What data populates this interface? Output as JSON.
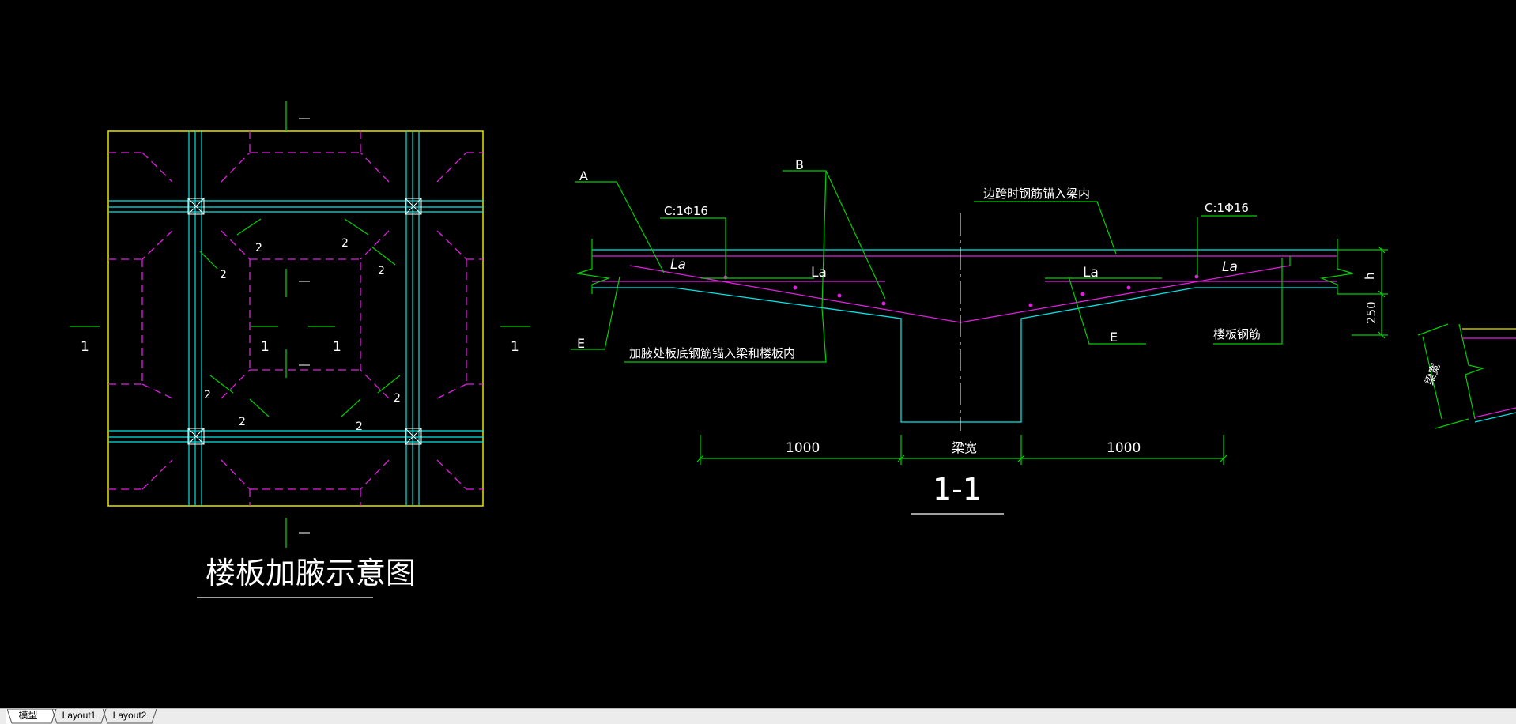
{
  "drawing": {
    "plan_title": "楼板加腋示意图",
    "section_title": "1-1",
    "plan_section_mark": "1",
    "plan_small_mark": "2",
    "label_A": "A",
    "label_B": "B",
    "label_E": "E",
    "label_La": "La",
    "rebar_left": "C:1Φ16",
    "rebar_right": "C:1Φ16",
    "note_edge_span": "边跨时钢筋锚入梁内",
    "note_haunch": "加腋处板底钢筋锚入梁和楼板内",
    "note_slab_rebar": "楼板钢筋",
    "dim_left": "1000",
    "dim_right": "1000",
    "dim_beam": "梁宽",
    "dim_h": "h",
    "dim_250": "250",
    "right_partial": "梁宽"
  },
  "tabs": [
    {
      "label": "模型",
      "active": true
    },
    {
      "label": "Layout1",
      "active": false
    },
    {
      "label": "Layout2",
      "active": false
    }
  ],
  "colors": {
    "background": "#000000",
    "yellow": "#e6e600",
    "cyan": "#00e5e5",
    "magenta": "#e020e0",
    "green": "#00d000",
    "white": "#ffffff"
  }
}
